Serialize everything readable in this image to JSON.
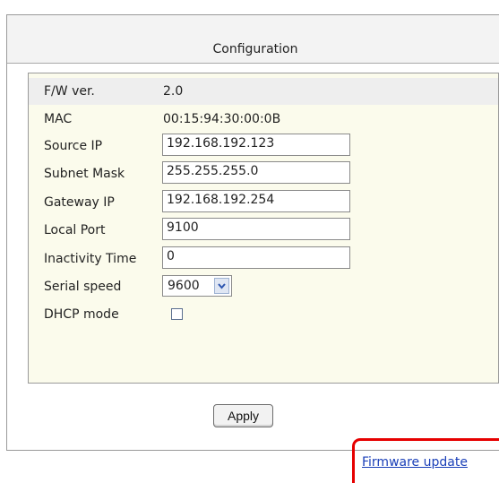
{
  "panel": {
    "title": "Configuration"
  },
  "config": {
    "fw_version": {
      "label": "F/W ver.",
      "value": "2.0"
    },
    "mac": {
      "label": "MAC",
      "value": "00:15:94:30:00:0B"
    },
    "source_ip": {
      "label": "Source IP",
      "value": "192.168.192.123"
    },
    "subnet_mask": {
      "label": "Subnet Mask",
      "value": "255.255.255.0"
    },
    "gateway_ip": {
      "label": "Gateway IP",
      "value": "192.168.192.254"
    },
    "local_port": {
      "label": "Local Port",
      "value": "9100"
    },
    "inactivity_time": {
      "label": "Inactivity Time",
      "value": "0"
    },
    "serial_speed": {
      "label": "Serial speed",
      "selected": "9600"
    },
    "dhcp_mode": {
      "label": "DHCP mode",
      "checked": false
    }
  },
  "actions": {
    "apply_label": "Apply"
  },
  "links": {
    "firmware_update": "Firmware update"
  },
  "colors": {
    "highlight": "#e60000",
    "link": "#1a3fb8",
    "config_background": "#fbfbec"
  }
}
